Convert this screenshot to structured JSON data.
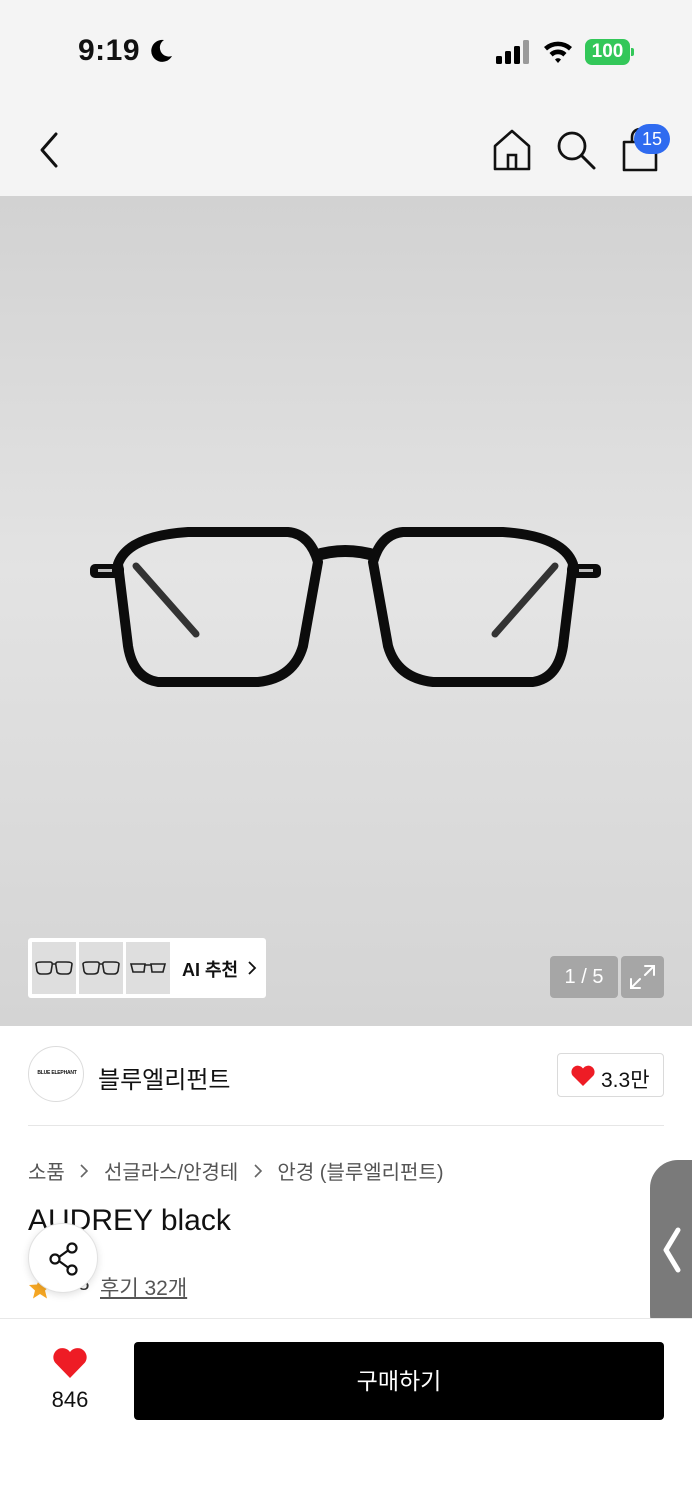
{
  "status_bar": {
    "time": "9:19",
    "battery_level": "100",
    "icons": [
      "moon-icon",
      "signal-icon",
      "wifi-icon",
      "battery-icon"
    ],
    "battery_color": "#33c759"
  },
  "nav": {
    "icons": [
      "back-arrow-icon",
      "home-icon",
      "search-icon",
      "shopping-bag-icon"
    ],
    "cart_badge": "15",
    "badge_color": "#2f6bf0"
  },
  "gallery": {
    "ai_label": "AI 추천",
    "page_counter": "1 / 5",
    "thumbnail_count": 3
  },
  "brand": {
    "logo_text": "BLUE ELEPHANT",
    "name": "블루엘리펀트",
    "like_count": "3.3만"
  },
  "breadcrumb": [
    "소품",
    "선글라스/안경테",
    "안경 (블루엘리펀트)"
  ],
  "product": {
    "name": "AUDREY black",
    "rating": ".8",
    "review_label": "후기 32개"
  },
  "bottom_bar": {
    "wish_count": "846",
    "buy_label": "구매하기",
    "heart_color": "#ee1c25"
  }
}
